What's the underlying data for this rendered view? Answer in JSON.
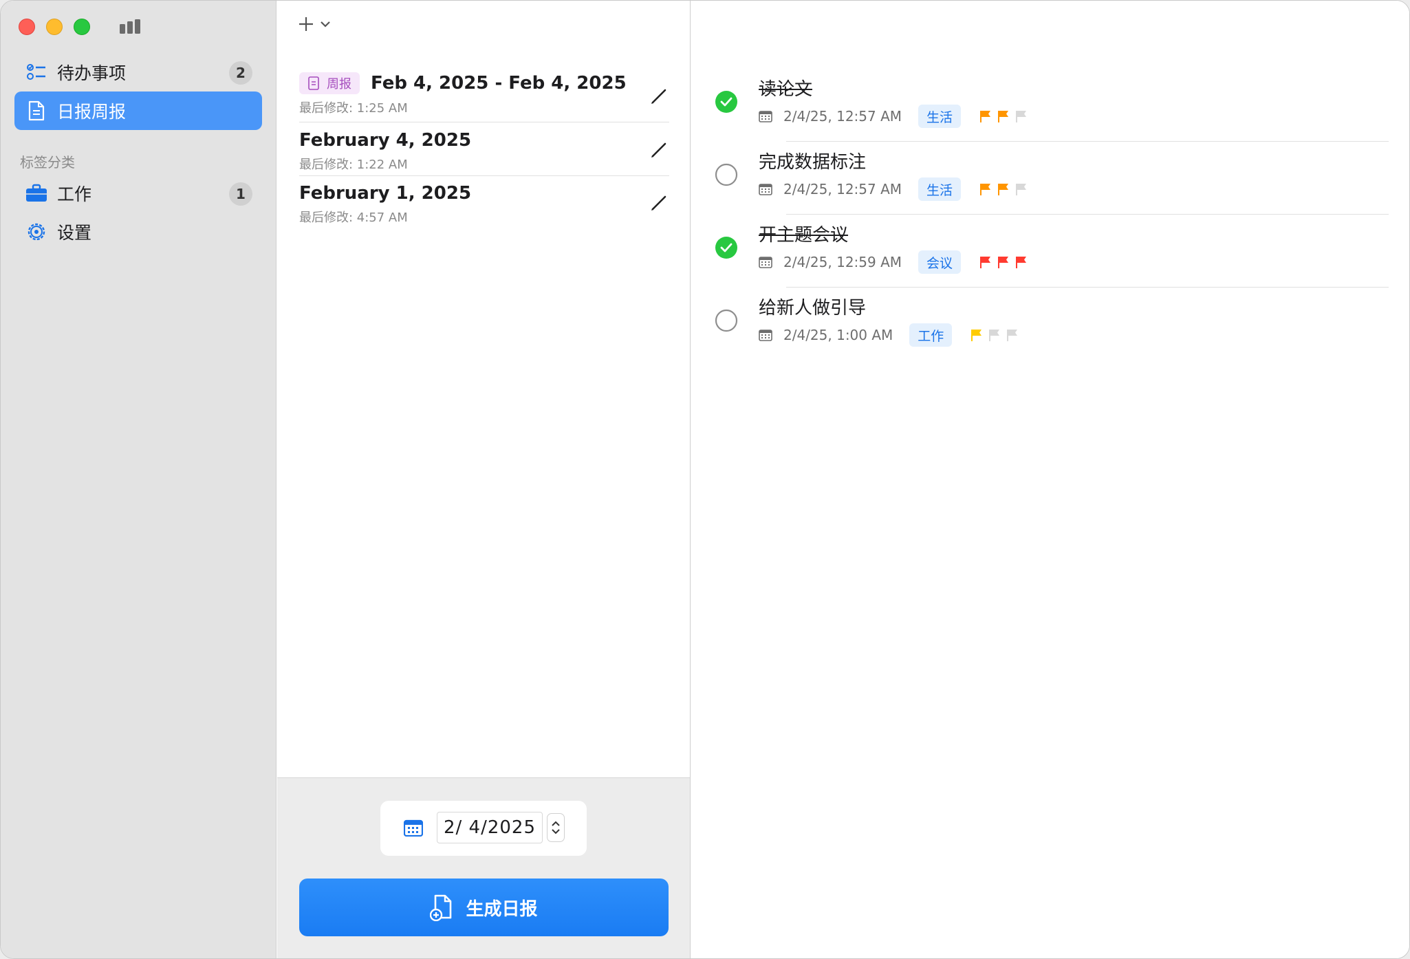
{
  "sidebar": {
    "items": [
      {
        "label": "待办事项",
        "badge": "2"
      },
      {
        "label": "日报周报"
      }
    ],
    "section_title": "标签分类",
    "tags": [
      {
        "label": "工作",
        "badge": "1"
      },
      {
        "label": "设置"
      }
    ]
  },
  "reports": [
    {
      "tag": "周报",
      "title": "Feb 4, 2025 - Feb 4, 2025",
      "modified": "最后修改: 1:25 AM"
    },
    {
      "title": "February 4, 2025",
      "modified": "最后修改: 1:22 AM"
    },
    {
      "title": "February 1, 2025",
      "modified": "最后修改: 4:57 AM"
    }
  ],
  "date_picker": {
    "value": "2/  4/2025"
  },
  "generate_button": {
    "label": "生成日报"
  },
  "todos": [
    {
      "title": "读论文",
      "done": true,
      "date": "2/4/25, 12:57 AM",
      "category": "生活",
      "priority": 2,
      "flag_color": "#ff9500"
    },
    {
      "title": "完成数据标注",
      "done": false,
      "date": "2/4/25, 12:57 AM",
      "category": "生活",
      "priority": 2,
      "flag_color": "#ff9500"
    },
    {
      "title": "开主题会议",
      "done": true,
      "date": "2/4/25, 12:59 AM",
      "category": "会议",
      "priority": 3,
      "flag_color": "#ff3b30"
    },
    {
      "title": "给新人做引导",
      "done": false,
      "date": "2/4/25, 1:00 AM",
      "category": "工作",
      "priority": 1,
      "flag_color": "#ffcc00"
    }
  ],
  "colors": {
    "accent": "#4a96f8",
    "done_green": "#28c840",
    "flag_empty": "#d8d8d8"
  }
}
